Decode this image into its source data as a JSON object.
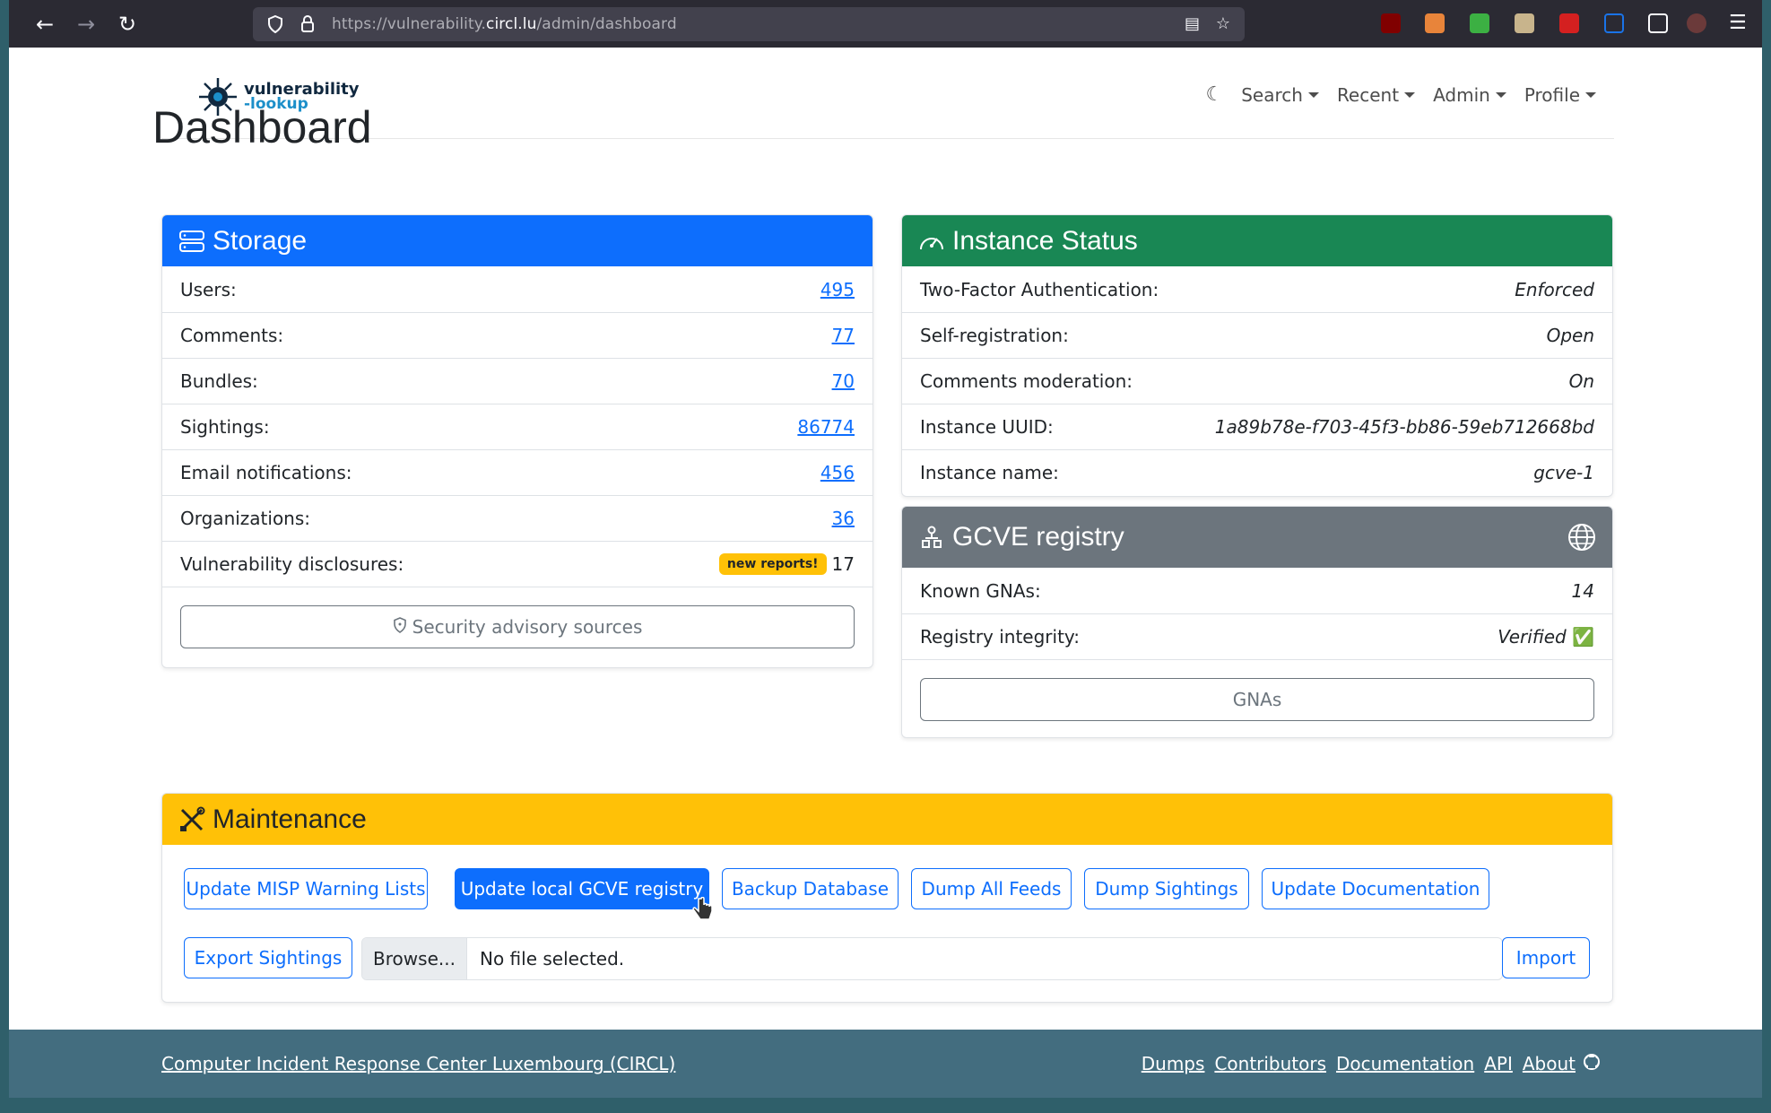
{
  "browser": {
    "url_prefix": "https://vulnerability.",
    "url_host": "circl.lu",
    "url_path": "/admin/dashboard"
  },
  "nav": {
    "logo_line1": "vulnerability",
    "logo_line2": "-lookup",
    "items": [
      "Search",
      "Recent",
      "Admin",
      "Profile"
    ]
  },
  "page_title": "Dashboard",
  "storage": {
    "title": "Storage",
    "rows": [
      {
        "label": "Users:",
        "value": "495"
      },
      {
        "label": "Comments:",
        "value": "77"
      },
      {
        "label": "Bundles:",
        "value": "70"
      },
      {
        "label": "Sightings:",
        "value": "86774"
      },
      {
        "label": "Email notifications:",
        "value": "456"
      },
      {
        "label": "Organizations:",
        "value": "36"
      }
    ],
    "disclosures_label": "Vulnerability disclosures:",
    "disclosures_badge": "new reports!",
    "disclosures_value": "17",
    "button": "Security advisory sources"
  },
  "instance": {
    "title": "Instance Status",
    "rows": [
      {
        "label": "Two-Factor Authentication:",
        "value": "Enforced"
      },
      {
        "label": "Self-registration:",
        "value": "Open"
      },
      {
        "label": "Comments moderation:",
        "value": "On"
      },
      {
        "label": "Instance UUID:",
        "value": "1a89b78e-f703-45f3-bb86-59eb712668bd"
      },
      {
        "label": "Instance name:",
        "value": "gcve-1"
      }
    ]
  },
  "gcve": {
    "title": "GCVE registry",
    "rows": [
      {
        "label": "Known GNAs:",
        "value": "14"
      },
      {
        "label": "Registry integrity:",
        "value": "Verified"
      }
    ],
    "verified_mark": "✅",
    "button": "GNAs"
  },
  "maintenance": {
    "title": "Maintenance",
    "buttons": [
      "Update MISP Warning Lists",
      "Update local GCVE registry",
      "Backup Database",
      "Dump All Feeds",
      "Dump Sightings",
      "Update Documentation"
    ],
    "export_button": "Export Sightings",
    "browse_label": "Browse...",
    "file_placeholder": "No file selected.",
    "import_button": "Import"
  },
  "footer": {
    "org_link": "Computer Incident Response Center Luxembourg (CIRCL)",
    "links": [
      "Dumps",
      "Contributors",
      "Documentation",
      "API",
      "About"
    ]
  },
  "colors": {
    "storage_header": "#0d6efd",
    "instance_header": "#198754",
    "gcve_header": "#6c757d",
    "maintenance_header": "#ffc107"
  }
}
